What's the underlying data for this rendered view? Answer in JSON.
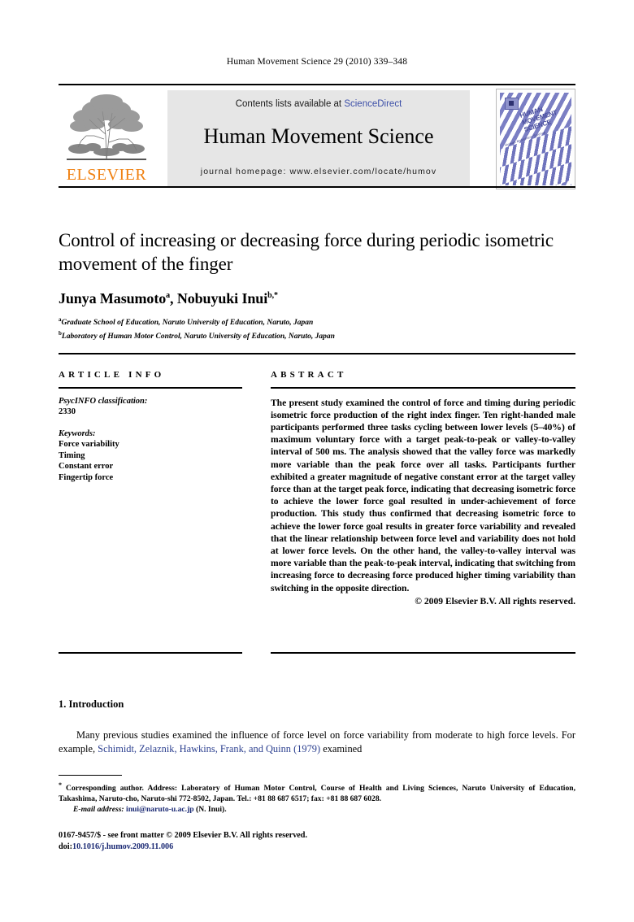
{
  "running_head": "Human Movement Science 29 (2010) 339–348",
  "masthead": {
    "contents_prefix": "Contents lists available at ",
    "sciencedirect": "ScienceDirect",
    "journal_name": "Human Movement Science",
    "homepage": "journal homepage: www.elsevier.com/locate/humov",
    "publisher_wordmark": "ELSEVIER",
    "cover_title_line1": "HUMAN",
    "cover_title_line2": "MOVEMENT",
    "cover_title_line3": "SCIENCE",
    "cover_micro_text": "Human Movement Science",
    "accent_orange": "#f08010",
    "link_blue": "#3c4fa8",
    "cover_purple": "#7b7fc4",
    "banner_gray": "#e6e6e6"
  },
  "title": "Control of increasing or decreasing force during periodic isometric movement of the finger",
  "authors": {
    "name1": "Junya Masumoto",
    "sup1": "a",
    "separator": ", ",
    "name2": "Nobuyuki Inui",
    "sup2": "b,",
    "corresponding_mark": "*"
  },
  "affiliations": [
    {
      "marker": "a",
      "text": "Graduate School of Education, Naruto University of Education, Naruto, Japan"
    },
    {
      "marker": "b",
      "text": "Laboratory of Human Motor Control, Naruto University of Education, Naruto, Japan"
    }
  ],
  "article_info": {
    "heading": "ARTICLE INFO",
    "classification_label": "PsycINFO classification:",
    "classification_value": "2330",
    "keywords_label": "Keywords:",
    "keywords": [
      "Force variability",
      "Timing",
      "Constant error",
      "Fingertip force"
    ]
  },
  "abstract": {
    "heading": "ABSTRACT",
    "text": "The present study examined the control of force and timing during periodic isometric force production of the right index finger. Ten right-handed male participants performed three tasks cycling between lower levels (5–40%) of maximum voluntary force with a target peak-to-peak or valley-to-valley interval of 500 ms. The analysis showed that the valley force was markedly more variable than the peak force over all tasks. Participants further exhibited a greater magnitude of negative constant error at the target valley force than at the target peak force, indicating that decreasing isometric force to achieve the lower force goal resulted in under-achievement of force production. This study thus confirmed that decreasing isometric force to achieve the lower force goal results in greater force variability and revealed that the linear relationship between force level and variability does not hold at lower force levels. On the other hand, the valley-to-valley interval was more variable than the peak-to-peak interval, indicating that switching from increasing force to decreasing force produced higher timing variability than switching in the opposite direction.",
    "copyright": "© 2009 Elsevier B.V. All rights reserved."
  },
  "introduction": {
    "heading": "1. Introduction",
    "text_before_cite": "Many previous studies examined the influence of force level on force variability from moderate to high force levels. For example, ",
    "citation": "Schimidt, Zelaznik, Hawkins, Frank, and Quinn (1979)",
    "text_after_cite": " examined"
  },
  "footnote": {
    "star": "*",
    "corresponding_text": " Corresponding author. Address: Laboratory of Human Motor Control, Course of Health and Living Sciences, Naruto University of Education, Takashima, Naruto-cho, Naruto-shi 772-8502, Japan. Tel.: +81 88 687 6517; fax: +81 88 687 6028.",
    "email_label": "E-mail address:",
    "email": "inui@naruto-u.ac.jp",
    "email_suffix": " (N. Inui)."
  },
  "imprint": {
    "issn_line": "0167-9457/$ - see front matter © 2009 Elsevier B.V. All rights reserved.",
    "doi_label": "doi:",
    "doi_value": "10.1016/j.humov.2009.11.006"
  }
}
